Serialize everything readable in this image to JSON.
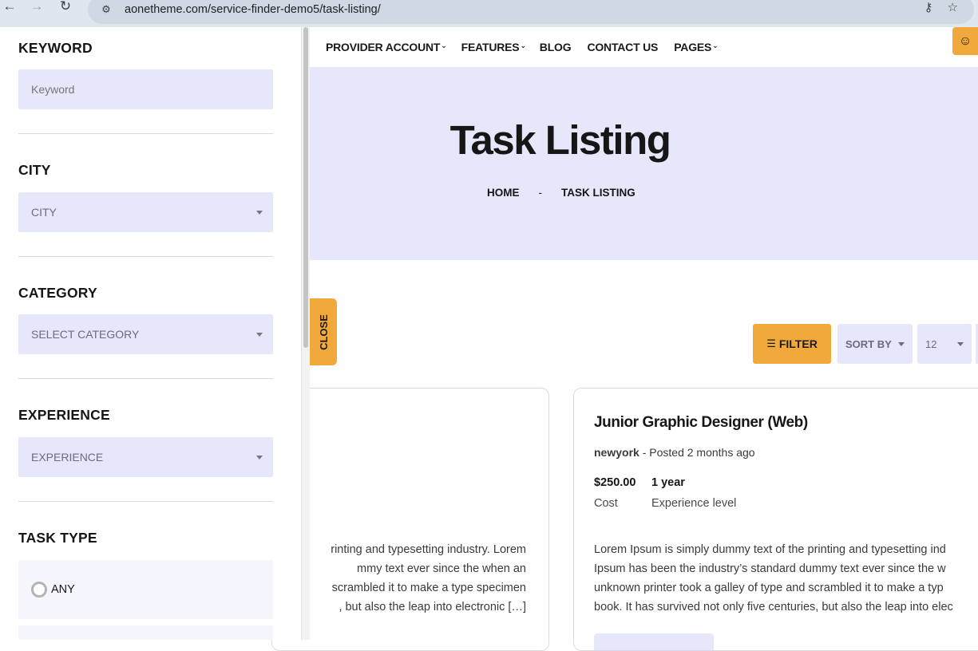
{
  "browser": {
    "url": "aonetheme.com/service-finder-demo5/task-listing/",
    "icons": [
      "back-arrow-icon",
      "forward-arrow-icon",
      "reload-icon",
      "site-settings-icon",
      "key-icon",
      "star-icon"
    ]
  },
  "nav": {
    "items": [
      {
        "label": "PROVIDER ACCOUNT",
        "has_dropdown": true
      },
      {
        "label": "FEATURES",
        "has_dropdown": true
      },
      {
        "label": "BLOG",
        "has_dropdown": false
      },
      {
        "label": "CONTACT US",
        "has_dropdown": false
      },
      {
        "label": "PAGES",
        "has_dropdown": true
      }
    ]
  },
  "hero": {
    "title": "Task Listing",
    "breadcrumb": {
      "home": "HOME",
      "separator": "-",
      "current": "TASK LISTING"
    }
  },
  "sidebar": {
    "keyword": {
      "title": "KEYWORD",
      "placeholder": "Keyword"
    },
    "city": {
      "title": "CITY",
      "selected": "CITY"
    },
    "category": {
      "title": "CATEGORY",
      "selected": "SELECT CATEGORY"
    },
    "experience": {
      "title": "EXPERIENCE",
      "selected": "EXPERIENCE"
    },
    "task_type": {
      "title": "TASK TYPE",
      "options": [
        "ANY"
      ]
    }
  },
  "controls": {
    "close_label": "CLOSE",
    "filter_label": "FILTER",
    "sort_label": "SORT BY",
    "per_page": "12"
  },
  "cards": {
    "left": {
      "desc_lines": [
        "rinting and typesetting industry. Lorem",
        "mmy text ever since the when an",
        "scrambled it to make a type specimen",
        ", but also the leap into electronic […]"
      ]
    },
    "right": {
      "title": "Junior Graphic Designer (Web)",
      "location": "newyork",
      "posted": "Posted 2 months ago",
      "cost_value": "$250.00",
      "cost_label": "Cost",
      "experience_value": "1 year",
      "experience_label": "Experience level",
      "desc_lines": [
        "Lorem Ipsum is simply dummy text of the printing and typesetting ind",
        "Ipsum has been the industry’s standard dummy text ever since the w",
        "unknown printer took a galley of type and scrambled it to make a typ",
        "book. It has survived not only five centuries, but also the leap into elec"
      ]
    }
  },
  "colors": {
    "accent": "#f2a93b",
    "field_bg": "#e6e7fb",
    "hero_bg": "#e6e7fb"
  }
}
